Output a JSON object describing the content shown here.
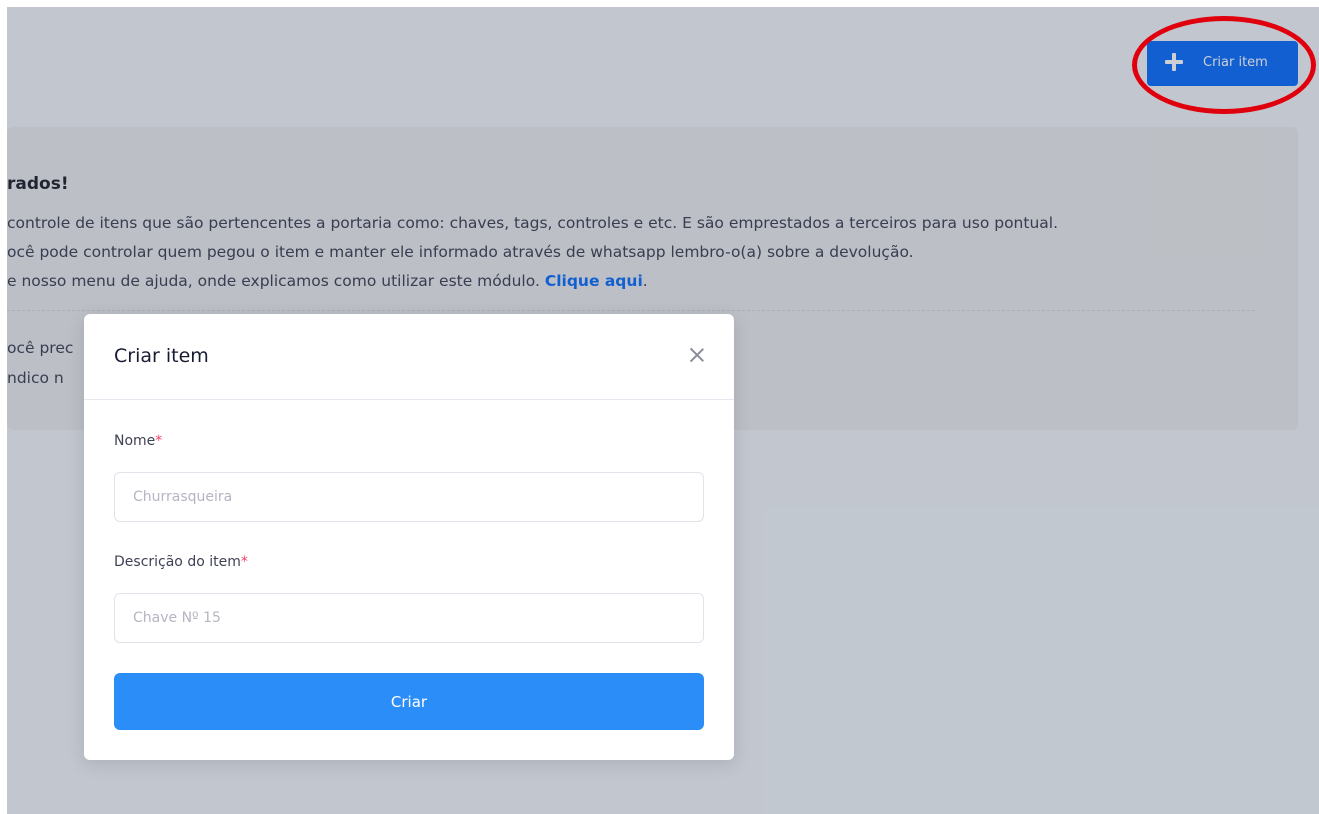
{
  "toolbar": {
    "create_button_label": "Criar item"
  },
  "info": {
    "title": "rados!",
    "line1": "controle de itens que são pertencentes a portaria como: chaves, tags, controles e etc. E são emprestados a terceiros para uso pontual.",
    "line2": "ocê pode controlar quem pegou o item e manter ele informado através de whatsapp lembro-o(a) sobre a devolução.",
    "line3_prefix": "e nosso menu de ajuda, onde explicamos como utilizar este módulo. ",
    "line3_link": "Clique aqui",
    "line3_suffix": ".",
    "line4": "ocê prec",
    "line5": "ndico n"
  },
  "modal": {
    "title": "Criar item",
    "fields": {
      "name_label": "Nome",
      "name_placeholder": "Churrasqueira",
      "description_label": "Descrição do item",
      "description_placeholder": "Chave Nº 15",
      "required_marker": "*"
    },
    "submit_label": "Criar"
  },
  "colors": {
    "primary": "#0d6efd",
    "submit": "#2b8ef8",
    "required": "#f1416c",
    "annotation": "#e0000d"
  }
}
